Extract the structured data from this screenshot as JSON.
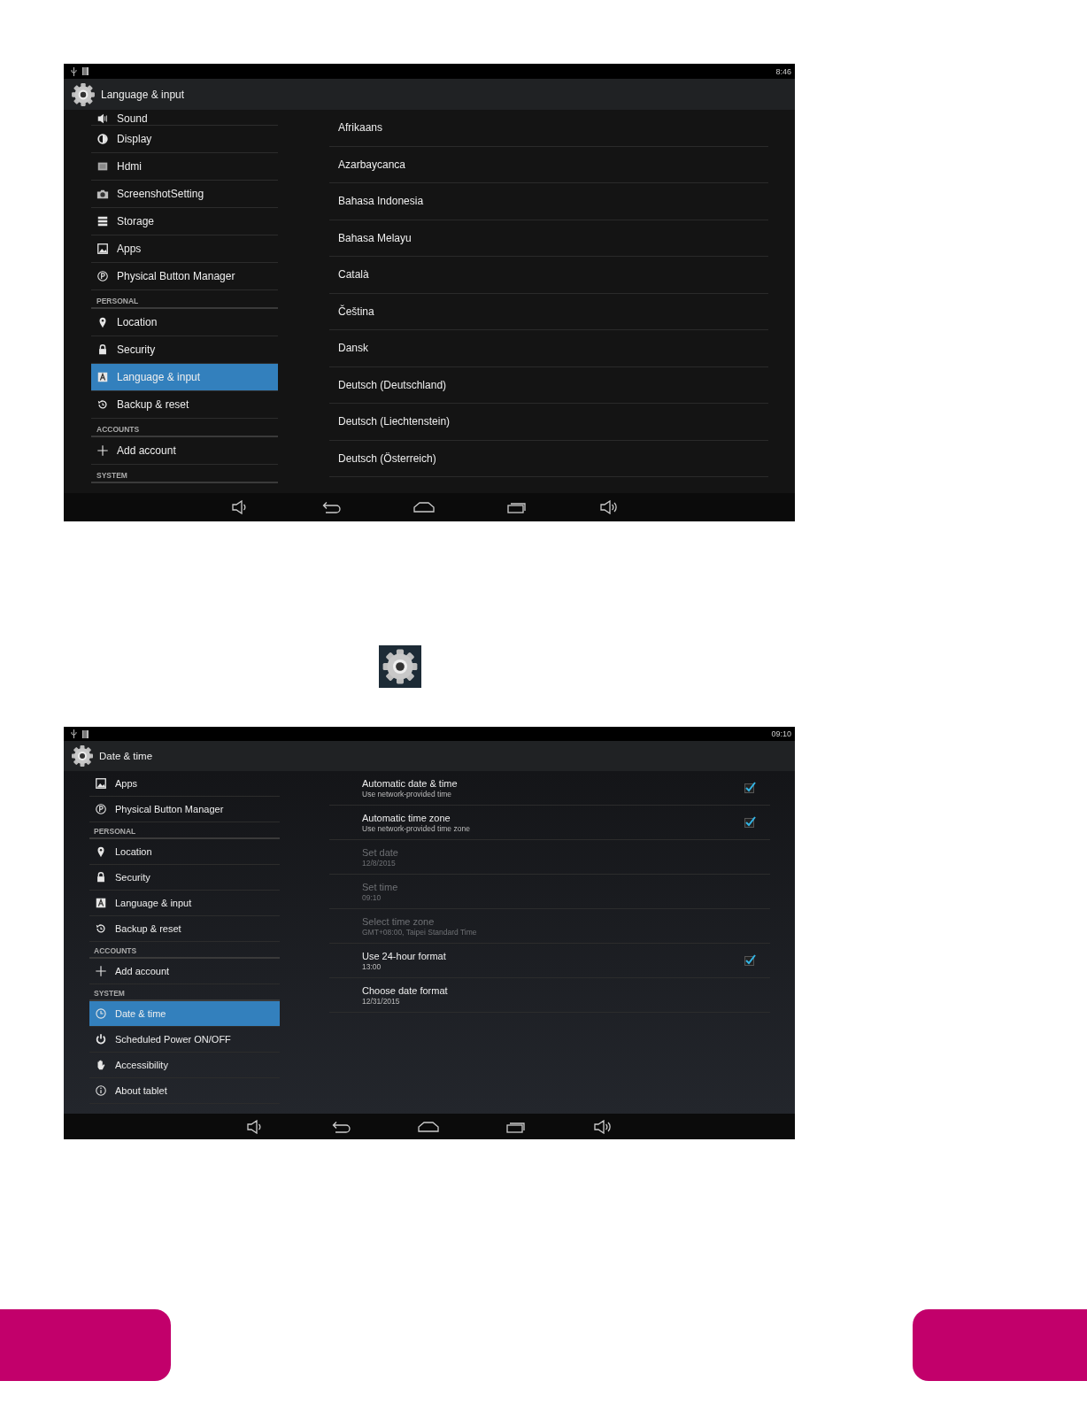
{
  "screens": [
    {
      "status_time": "8:46",
      "title": "Language & input",
      "sidebar": [
        {
          "kind": "item",
          "label": "Sound",
          "selected": false
        },
        {
          "kind": "item",
          "label": "Display",
          "selected": false
        },
        {
          "kind": "item",
          "label": "Hdmi",
          "selected": false
        },
        {
          "kind": "item",
          "label": "ScreenshotSetting",
          "selected": false
        },
        {
          "kind": "item",
          "label": "Storage",
          "selected": false
        },
        {
          "kind": "item",
          "label": "Apps",
          "selected": false
        },
        {
          "kind": "item",
          "label": "Physical Button Manager",
          "selected": false
        },
        {
          "kind": "header",
          "label": "PERSONAL"
        },
        {
          "kind": "item",
          "label": "Location",
          "selected": false
        },
        {
          "kind": "item",
          "label": "Security",
          "selected": false
        },
        {
          "kind": "item",
          "label": "Language & input",
          "selected": true
        },
        {
          "kind": "item",
          "label": "Backup & reset",
          "selected": false
        },
        {
          "kind": "header",
          "label": "ACCOUNTS"
        },
        {
          "kind": "item",
          "label": "Add account",
          "selected": false
        },
        {
          "kind": "header",
          "label": "SYSTEM"
        }
      ],
      "languages": [
        "Afrikaans",
        "Azarbaycanca",
        "Bahasa Indonesia",
        "Bahasa Melayu",
        "Català",
        "Čeština",
        "Dansk",
        "Deutsch (Deutschland)",
        "Deutsch (Liechtenstein)",
        "Deutsch (Österreich)"
      ]
    },
    {
      "status_time": "09:10",
      "title": "Date & time",
      "sidebar": [
        {
          "kind": "item",
          "label": "Apps",
          "selected": false
        },
        {
          "kind": "item",
          "label": "Physical Button Manager",
          "selected": false
        },
        {
          "kind": "header",
          "label": "PERSONAL"
        },
        {
          "kind": "item",
          "label": "Location",
          "selected": false
        },
        {
          "kind": "item",
          "label": "Security",
          "selected": false
        },
        {
          "kind": "item",
          "label": "Language & input",
          "selected": false
        },
        {
          "kind": "item",
          "label": "Backup & reset",
          "selected": false
        },
        {
          "kind": "header",
          "label": "ACCOUNTS"
        },
        {
          "kind": "item",
          "label": "Add account",
          "selected": false
        },
        {
          "kind": "header",
          "label": "SYSTEM"
        },
        {
          "kind": "item",
          "label": "Date & time",
          "selected": true
        },
        {
          "kind": "item",
          "label": "Scheduled Power ON/OFF",
          "selected": false
        },
        {
          "kind": "item",
          "label": "Accessibility",
          "selected": false
        },
        {
          "kind": "item",
          "label": "About tablet",
          "selected": false
        }
      ],
      "settings": [
        {
          "kind": "checkbox",
          "title": "Automatic date & time",
          "summary": "Use network-provided time",
          "disabled": false,
          "checked": true
        },
        {
          "kind": "checkbox",
          "title": "Automatic time zone",
          "summary": "Use network-provided time zone",
          "disabled": false,
          "checked": true
        },
        {
          "kind": "plain",
          "title": "Set date",
          "summary": "12/8/2015",
          "disabled": true
        },
        {
          "kind": "plain",
          "title": "Set time",
          "summary": "09:10",
          "disabled": true
        },
        {
          "kind": "plain",
          "title": "Select time zone",
          "summary": "GMT+08:00, Taipei Standard Time",
          "disabled": true
        },
        {
          "kind": "checkbox",
          "title": "Use 24-hour format",
          "summary": "13:00",
          "disabled": false,
          "checked": true
        },
        {
          "kind": "plain",
          "title": "Choose date format",
          "summary": "12/31/2015",
          "disabled": false
        }
      ]
    }
  ]
}
